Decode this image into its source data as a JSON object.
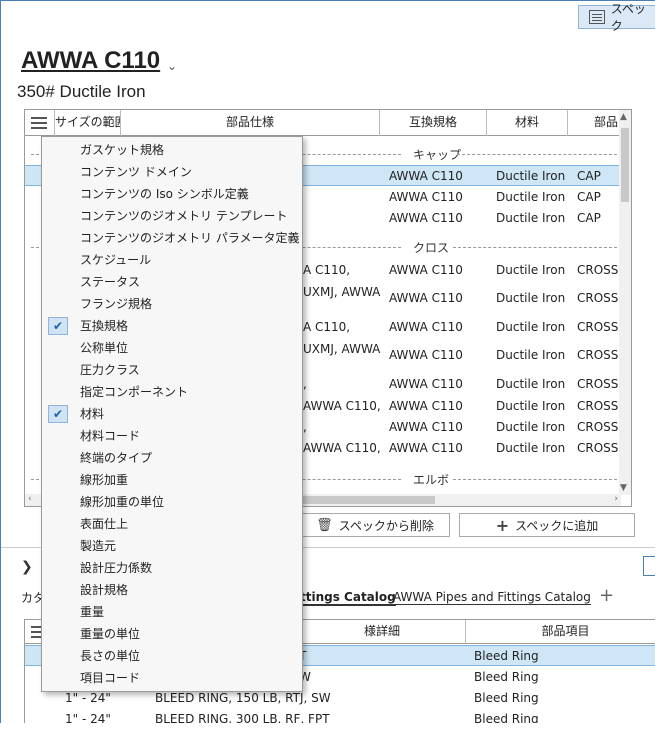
{
  "spec_button_label": "スペック",
  "title": "AWWA C110",
  "subtitle": "350# Ductile Iron",
  "grid": {
    "headers": [
      "サイズの範囲",
      "部品仕様",
      "互換規格",
      "材料",
      "部品"
    ],
    "groups": [
      "キャップ",
      "クロス",
      "エルボ"
    ],
    "rows": [
      {
        "desc": "",
        "std": "AWWA C110",
        "mat": "Ductile Iron",
        "item": "CAP"
      },
      {
        "desc": "",
        "std": "AWWA C110",
        "mat": "Ductile Iron",
        "item": "CAP"
      },
      {
        "desc": "",
        "std": "AWWA C110",
        "mat": "Ductile Iron",
        "item": "CAP"
      },
      {
        "desc": "A C110,",
        "std": "AWWA C110",
        "mat": "Ductile Iron",
        "item": "CROSS"
      },
      {
        "desc": "UXMJ, AWWA",
        "std": "AWWA C110",
        "mat": "Ductile Iron",
        "item": "CROSS"
      },
      {
        "desc": "A C110,",
        "std": "AWWA C110",
        "mat": "Ductile Iron",
        "item": "CROSS"
      },
      {
        "desc": "UXMJ, AWWA",
        "std": "AWWA C110",
        "mat": "Ductile Iron",
        "item": "CROSS"
      },
      {
        "desc": ",",
        "std": "AWWA C110",
        "mat": "Ductile Iron",
        "item": "CROSS"
      },
      {
        "desc": "AWWA C110,",
        "std": "AWWA C110",
        "mat": "Ductile Iron",
        "item": "CROSS"
      },
      {
        "desc": ",",
        "std": "AWWA C110",
        "mat": "Ductile Iron",
        "item": "CROSS"
      },
      {
        "desc": "AWWA C110,",
        "std": "AWWA C110",
        "mat": "Ductile Iron",
        "item": "CROSS"
      }
    ]
  },
  "remove_button": "スペックから削除",
  "add_button": "スペックに追加",
  "catalog": {
    "label": "カタ",
    "tab_active": "ttings Catalog",
    "tab_other": "AWWA Pipes and Fittings Catalog"
  },
  "grid2": {
    "headers": [
      "様詳細",
      "部品項目"
    ],
    "rows": [
      {
        "size": "",
        "desc": "T",
        "item": "Bleed Ring"
      },
      {
        "size": "",
        "desc": "W",
        "item": "Bleed Ring"
      },
      {
        "size": "1\" - 24\"",
        "desc": "BLEED RING, 150 LB, RTJ, SW",
        "item": "Bleed Ring"
      },
      {
        "size": "1\" - 24\"",
        "desc": "BLEED RING, 300 LB, RF, FPT",
        "item": "Bleed Ring"
      }
    ]
  },
  "menu": [
    {
      "label": "ガスケット規格",
      "checked": false
    },
    {
      "label": "コンテンツ ドメイン",
      "checked": false
    },
    {
      "label": "コンテンツの Iso シンボル定義",
      "checked": false
    },
    {
      "label": "コンテンツのジオメトリ テンプレート",
      "checked": false
    },
    {
      "label": "コンテンツのジオメトリ パラメータ定義",
      "checked": false
    },
    {
      "label": "スケジュール",
      "checked": false
    },
    {
      "label": "ステータス",
      "checked": false
    },
    {
      "label": "フランジ規格",
      "checked": false
    },
    {
      "label": "互換規格",
      "checked": true
    },
    {
      "label": "公称単位",
      "checked": false
    },
    {
      "label": "圧力クラス",
      "checked": false
    },
    {
      "label": "指定コンポーネント",
      "checked": false
    },
    {
      "label": "材料",
      "checked": true
    },
    {
      "label": "材料コード",
      "checked": false
    },
    {
      "label": "終端のタイプ",
      "checked": false
    },
    {
      "label": "線形加重",
      "checked": false
    },
    {
      "label": "線形加重の単位",
      "checked": false
    },
    {
      "label": "表面仕上",
      "checked": false
    },
    {
      "label": "製造元",
      "checked": false
    },
    {
      "label": "設計圧力係数",
      "checked": false
    },
    {
      "label": "設計規格",
      "checked": false
    },
    {
      "label": "重量",
      "checked": false
    },
    {
      "label": "重量の単位",
      "checked": false
    },
    {
      "label": "長さの単位",
      "checked": false
    },
    {
      "label": "項目コード",
      "checked": false
    }
  ]
}
